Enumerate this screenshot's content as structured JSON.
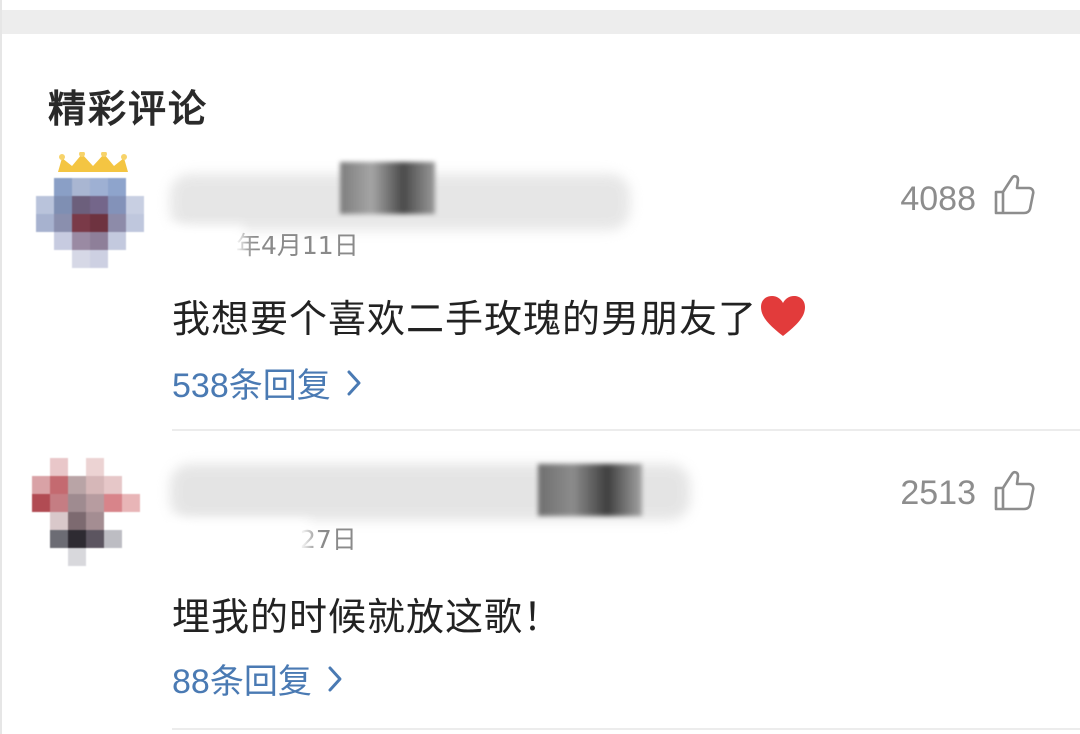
{
  "section": {
    "title": "精彩评论"
  },
  "comments": [
    {
      "date_visible": "年4月11日",
      "likes": "4088",
      "content": "我想要个喜欢二手玫瑰的男朋友了",
      "replies": "538条回复"
    },
    {
      "date_visible": "27日",
      "likes": "2513",
      "content": "埋我的时候就放这歌！",
      "replies": "88条回复"
    }
  ],
  "colors": {
    "reply_link": "#4a7ab3",
    "likes_text": "#8d8d8d",
    "heart": "#e23b3b",
    "crown": "#f4c542"
  },
  "icons": {
    "like": "thumbs-up-icon",
    "heart": "heart-icon",
    "chevron": "chevron-right-icon",
    "crown": "crown-icon"
  }
}
